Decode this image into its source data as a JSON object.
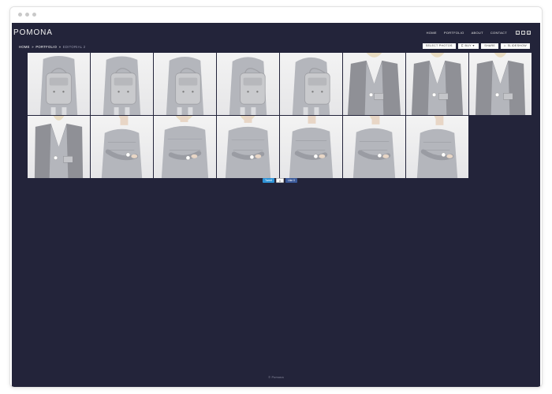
{
  "site": {
    "logo": "POMONA",
    "nav": [
      "HOME",
      "PORTFOLIO",
      "ABOUT",
      "CONTACT"
    ],
    "social_icons": [
      "pinterest-icon",
      "twitter-icon",
      "instagram-icon"
    ]
  },
  "breadcrumb": {
    "home": "HOME",
    "portfolio": "PORTFOLIO",
    "current": "EDITORIAL 2",
    "separator": "»"
  },
  "toolbar": {
    "select": "SELECT PHOTOS",
    "buy": "BUY",
    "share": "SHARE",
    "slideshow": "SLIDESHOW"
  },
  "gallery": {
    "photos": [
      {
        "type": "backpack-standing"
      },
      {
        "type": "backpack-closeup"
      },
      {
        "type": "backpack-hand"
      },
      {
        "type": "backpack-back"
      },
      {
        "type": "backpack-side"
      },
      {
        "type": "coat-sweater"
      },
      {
        "type": "coat-clutch"
      },
      {
        "type": "coat-watch"
      },
      {
        "type": "coat-full"
      },
      {
        "type": "sweater-watch"
      },
      {
        "type": "sweater-arms"
      },
      {
        "type": "sweater-hair"
      },
      {
        "type": "sweater-crossed"
      },
      {
        "type": "sweater-loose"
      },
      {
        "type": "sweater-sleeve"
      }
    ]
  },
  "share": {
    "tweet": "Tweet",
    "count": "0",
    "like": "Like 0"
  },
  "footer": {
    "copyright": "© Pomona"
  }
}
